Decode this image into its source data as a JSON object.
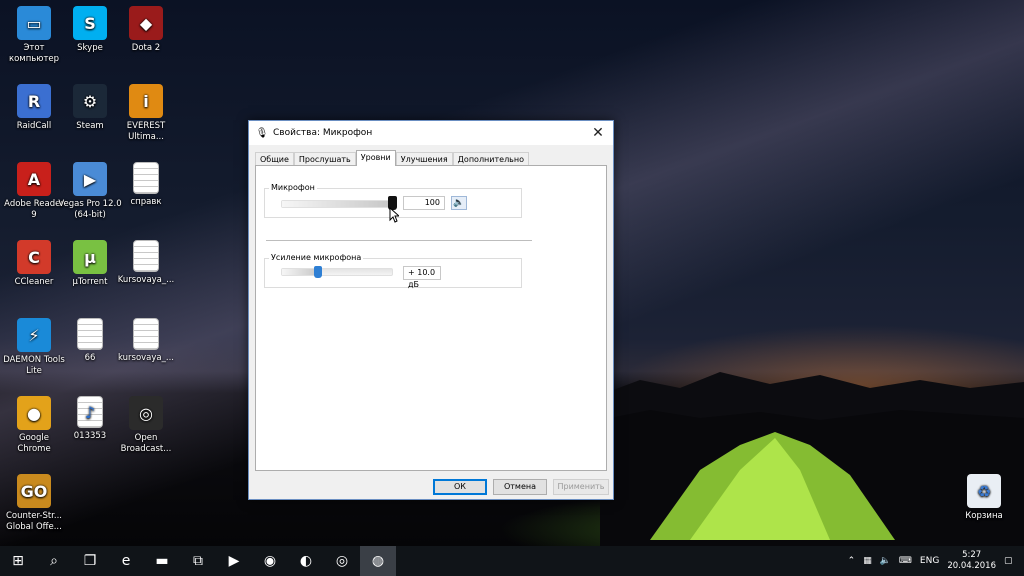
{
  "desktop": {
    "icons": [
      {
        "label": "Этот компьютер",
        "icon": "computer-icon",
        "color": "#2a8ad8"
      },
      {
        "label": "Skype",
        "icon": "skype-icon",
        "color": "#00aff0"
      },
      {
        "label": "Dota 2",
        "icon": "dota2-icon",
        "color": "#9a1b1b"
      },
      {
        "label": "RaidCall",
        "icon": "raidcall-icon",
        "color": "#3b6fd1"
      },
      {
        "label": "Steam",
        "icon": "steam-icon",
        "color": "#1b2838"
      },
      {
        "label": "EVEREST Ultima...",
        "icon": "everest-icon",
        "color": "#e08a12"
      },
      {
        "label": "Adobe Reader 9",
        "icon": "adobe-reader-icon",
        "color": "#c8201b"
      },
      {
        "label": "Vegas Pro 12.0 (64-bit)",
        "icon": "vegas-pro-icon",
        "color": "#4a8bd6"
      },
      {
        "label": "справк",
        "icon": "document-icon",
        "color": "#ffffff"
      },
      {
        "label": "CCleaner",
        "icon": "ccleaner-icon",
        "color": "#d23a2a"
      },
      {
        "label": "µTorrent",
        "icon": "utorrent-icon",
        "color": "#79c142"
      },
      {
        "label": "Kursovaya_...",
        "icon": "word-document-icon",
        "color": "#ffffff"
      },
      {
        "label": "DAEMON Tools Lite",
        "icon": "daemon-tools-icon",
        "color": "#1a8ad8"
      },
      {
        "label": "66",
        "icon": "document-icon",
        "color": "#ffffff"
      },
      {
        "label": "kursovaya_...",
        "icon": "word-document-icon",
        "color": "#ffffff"
      },
      {
        "label": "Google Chrome",
        "icon": "chrome-icon",
        "color": "#e3a21a"
      },
      {
        "label": "013353",
        "icon": "mp3-file-icon",
        "color": "#ffffff"
      },
      {
        "label": "Open Broadcast...",
        "icon": "obs-icon",
        "color": "#2b2b2b"
      },
      {
        "label": "Counter-Str... Global Offe...",
        "icon": "csgo-icon",
        "color": "#c98a1e"
      }
    ],
    "recycle_bin": {
      "label": "Корзина",
      "icon": "recycle-bin-icon"
    }
  },
  "dialog": {
    "title": "Свойства: Микрофон",
    "tabs": [
      {
        "label": "Общие",
        "selected": false
      },
      {
        "label": "Прослушать",
        "selected": false
      },
      {
        "label": "Уровни",
        "selected": true
      },
      {
        "label": "Улучшения",
        "selected": false
      },
      {
        "label": "Дополнительно",
        "selected": false
      }
    ],
    "microphone": {
      "label": "Микрофон",
      "value": "100",
      "level": 1.0
    },
    "boost": {
      "label": "Усиление микрофона",
      "value": "+ 10.0 дБ",
      "level": 0.33
    },
    "buttons": {
      "ok": "ОК",
      "cancel": "Отмена",
      "apply": "Применить"
    }
  },
  "taskbar": {
    "language": "ENG",
    "time": "5:27",
    "date": "20.04.2016",
    "apps": [
      "windows-start-icon",
      "search-icon",
      "task-view-icon",
      "edge-icon",
      "file-explorer-icon",
      "store-icon",
      "media-player-icon",
      "chrome-icon",
      "raidcall-icon",
      "obs-icon",
      "sound-recorder-icon"
    ]
  }
}
